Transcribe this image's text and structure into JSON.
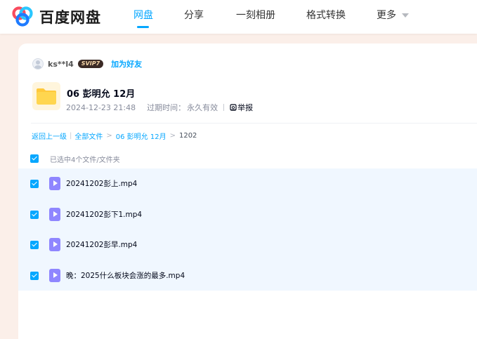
{
  "nav": {
    "logo_text": "百度网盘",
    "items": [
      {
        "label": "网盘",
        "active": true
      },
      {
        "label": "分享",
        "active": false
      },
      {
        "label": "一刻相册",
        "active": false
      },
      {
        "label": "格式转换",
        "active": false
      },
      {
        "label": "更多",
        "active": false
      }
    ],
    "more_icon": "chevron-down-icon",
    "accent_color": "#06a7ff"
  },
  "share": {
    "owner_name": "ks**l4",
    "owner_badge": "SVIP7",
    "add_friend_label": "加为好友",
    "folder_name": "06 彭明允 12月",
    "created_at": "2024-12-23 21:48",
    "expire_label": "过期时间：",
    "expire_value": "永久有效",
    "report_label": "举报",
    "folder_icon": "folder-icon"
  },
  "breadcrumb": {
    "back_label": "返回上一级",
    "all_files_label": "全部文件",
    "parent_label": "06 彭明允 12月",
    "current_label": "1202"
  },
  "selection": {
    "label": "已选中4个文件/文件夹",
    "all_checked": true
  },
  "files": [
    {
      "name": "20241202彭上.mp4",
      "checked": true,
      "icon": "video-file-icon"
    },
    {
      "name": "20241202彭下1.mp4",
      "checked": true,
      "icon": "video-file-icon"
    },
    {
      "name": "20241202彭早.mp4",
      "checked": true,
      "icon": "video-file-icon"
    },
    {
      "name": "晚：2025什么板块会涨的最多.mp4",
      "checked": true,
      "icon": "video-file-icon"
    }
  ]
}
